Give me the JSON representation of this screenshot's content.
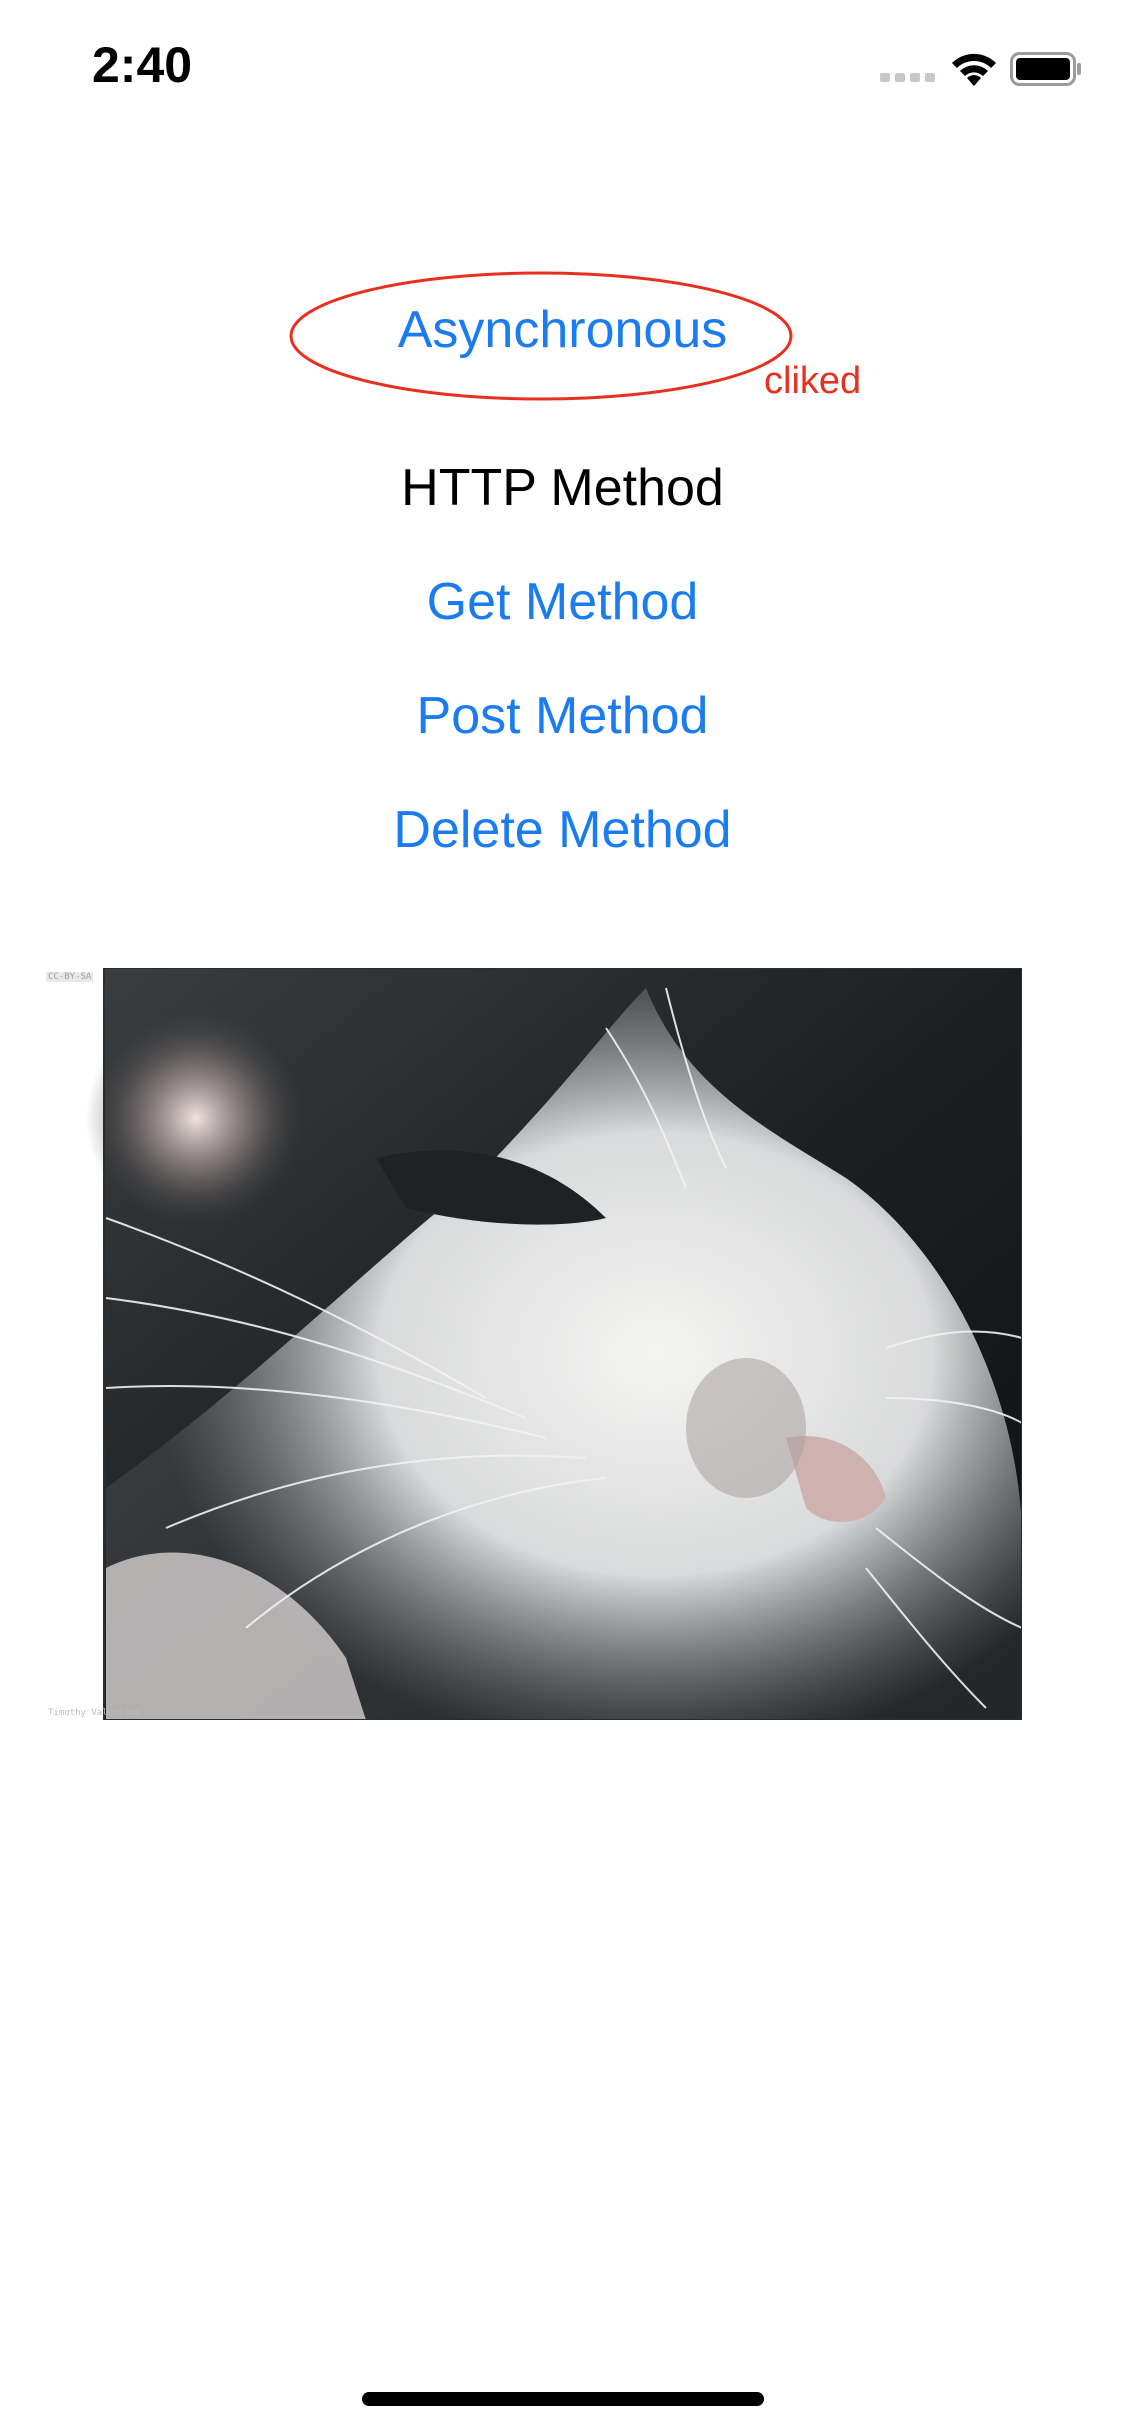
{
  "status_bar": {
    "time": "2:40"
  },
  "menu": {
    "async_label": "Asynchronous",
    "section_heading": "HTTP Method",
    "get_label": "Get Method",
    "post_label": "Post Method",
    "delete_label": "Delete Method"
  },
  "annotation": {
    "text": "cliked",
    "color": "#e8301e"
  },
  "photo": {
    "subject": "cat-photo",
    "credit_top": "CC-BY-SA",
    "credit_bottom": "Timothy Valentine"
  },
  "colors": {
    "link": "#1a7cf0",
    "text": "#000000"
  }
}
